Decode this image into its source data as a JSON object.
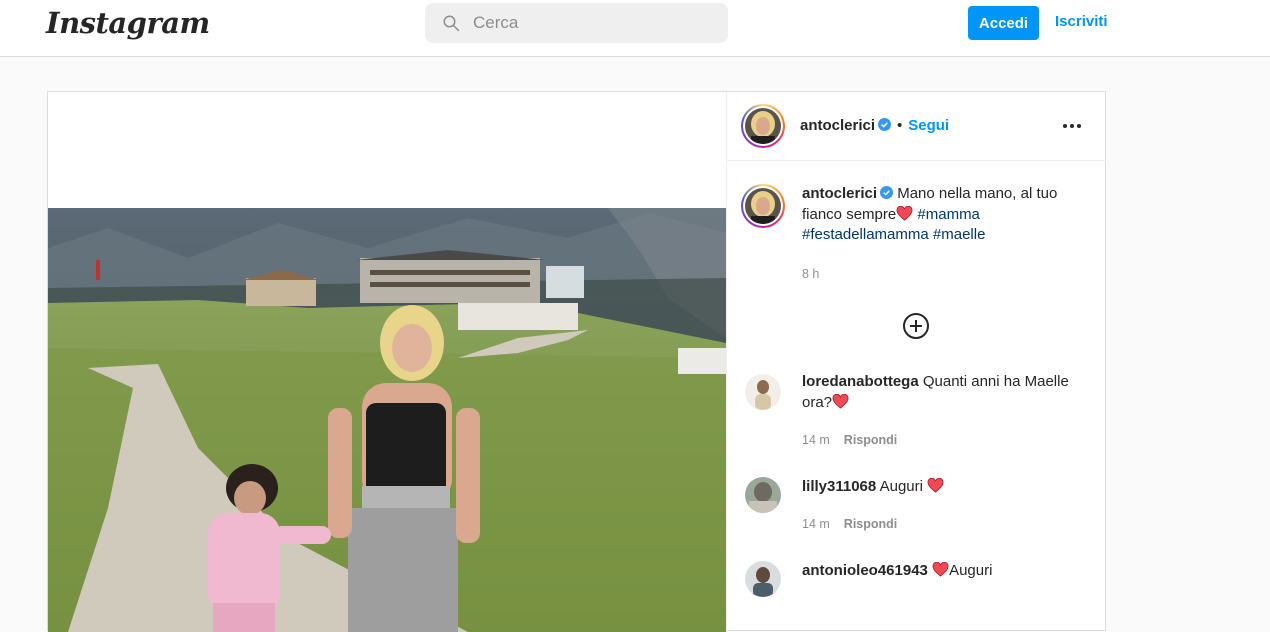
{
  "nav": {
    "logo": "Instagram",
    "search_placeholder": "Cerca",
    "login_label": "Accedi",
    "signup_label": "Iscriviti"
  },
  "post": {
    "author": "antoclerici",
    "follow_label": "Segui",
    "separator": "•",
    "caption": {
      "username": "antoclerici",
      "text": "Mano nella mano, al tuo fianco sempre",
      "hashtags": [
        "#mamma",
        "#festadellamamma",
        "#maelle"
      ],
      "time": "8 h"
    },
    "comments": [
      {
        "username": "loredanabottega",
        "text": "Quanti anni ha Maelle ora?",
        "heart": true,
        "time": "14 m",
        "reply_label": "Rispondi"
      },
      {
        "username": "lilly311068",
        "text": "Auguri",
        "heart": true,
        "time": "14 m",
        "reply_label": "Rispondi"
      },
      {
        "username": "antonioleo461943",
        "text": "Auguri",
        "heart_before": true,
        "time": "",
        "reply_label": ""
      }
    ]
  },
  "colors": {
    "accent": "#0095f6",
    "hashtag": "#00376b",
    "heart": "#ed4956"
  },
  "icons": [
    "search-icon",
    "verified-badge-icon",
    "more-options-icon",
    "add-icon",
    "heart-emoji-icon"
  ]
}
